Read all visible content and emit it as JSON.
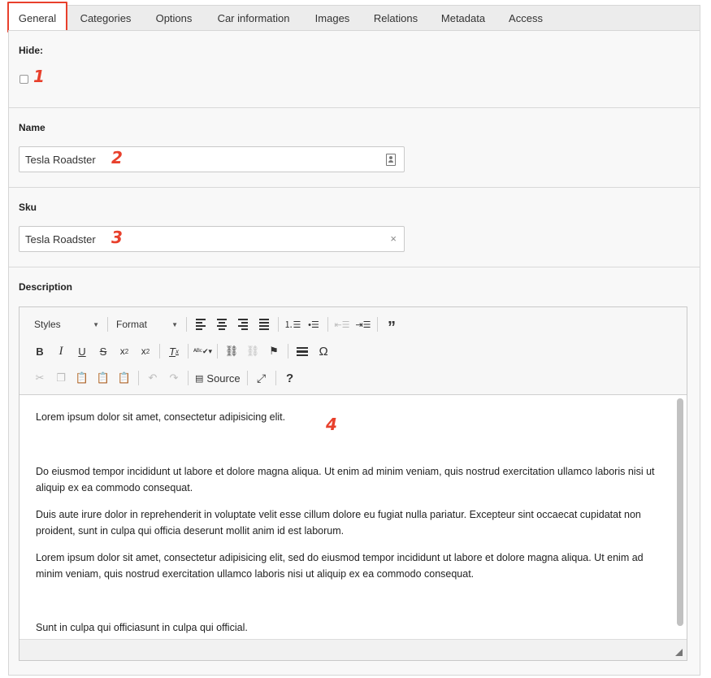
{
  "tabs": [
    {
      "label": "General",
      "active": true
    },
    {
      "label": "Categories"
    },
    {
      "label": "Options"
    },
    {
      "label": "Car information"
    },
    {
      "label": "Images"
    },
    {
      "label": "Relations"
    },
    {
      "label": "Metadata"
    },
    {
      "label": "Access"
    }
  ],
  "hide": {
    "label": "Hide:",
    "checked": false,
    "marker": "1"
  },
  "name": {
    "label": "Name",
    "value": "Tesla Roadster",
    "marker": "2"
  },
  "sku": {
    "label": "Sku",
    "value": "Tesla Roadster",
    "marker": "3",
    "clear_glyph": "×"
  },
  "description": {
    "label": "Description",
    "marker": "4",
    "toolbar": {
      "styles_label": "Styles",
      "format_label": "Format",
      "source_label": "Source",
      "help_label": "?"
    },
    "paragraphs": [
      "Lorem ipsum dolor sit amet, consectetur adipisicing elit.",
      "Do eiusmod tempor incididunt ut labore et dolore magna aliqua. Ut enim ad minim veniam, quis nostrud exercitation ullamco laboris nisi ut aliquip ex ea commodo consequat.",
      "Duis aute irure dolor in reprehenderit in voluptate velit esse cillum dolore eu fugiat nulla pariatur. Excepteur sint occaecat cupidatat non proident, sunt in culpa qui officia deserunt mollit anim id est laborum.",
      "Lorem ipsum dolor sit amet, consectetur adipisicing elit, sed do eiusmod tempor incididunt ut labore et dolore magna aliqua. Ut enim ad minim veniam, quis nostrud exercitation ullamco laboris nisi ut aliquip ex ea commodo consequat.",
      "Sunt in culpa qui officiasunt in culpa qui official."
    ]
  },
  "colors": {
    "accent": "#e8402c",
    "panel_bg": "#f8f8f8",
    "tab_bg": "#ececec"
  }
}
